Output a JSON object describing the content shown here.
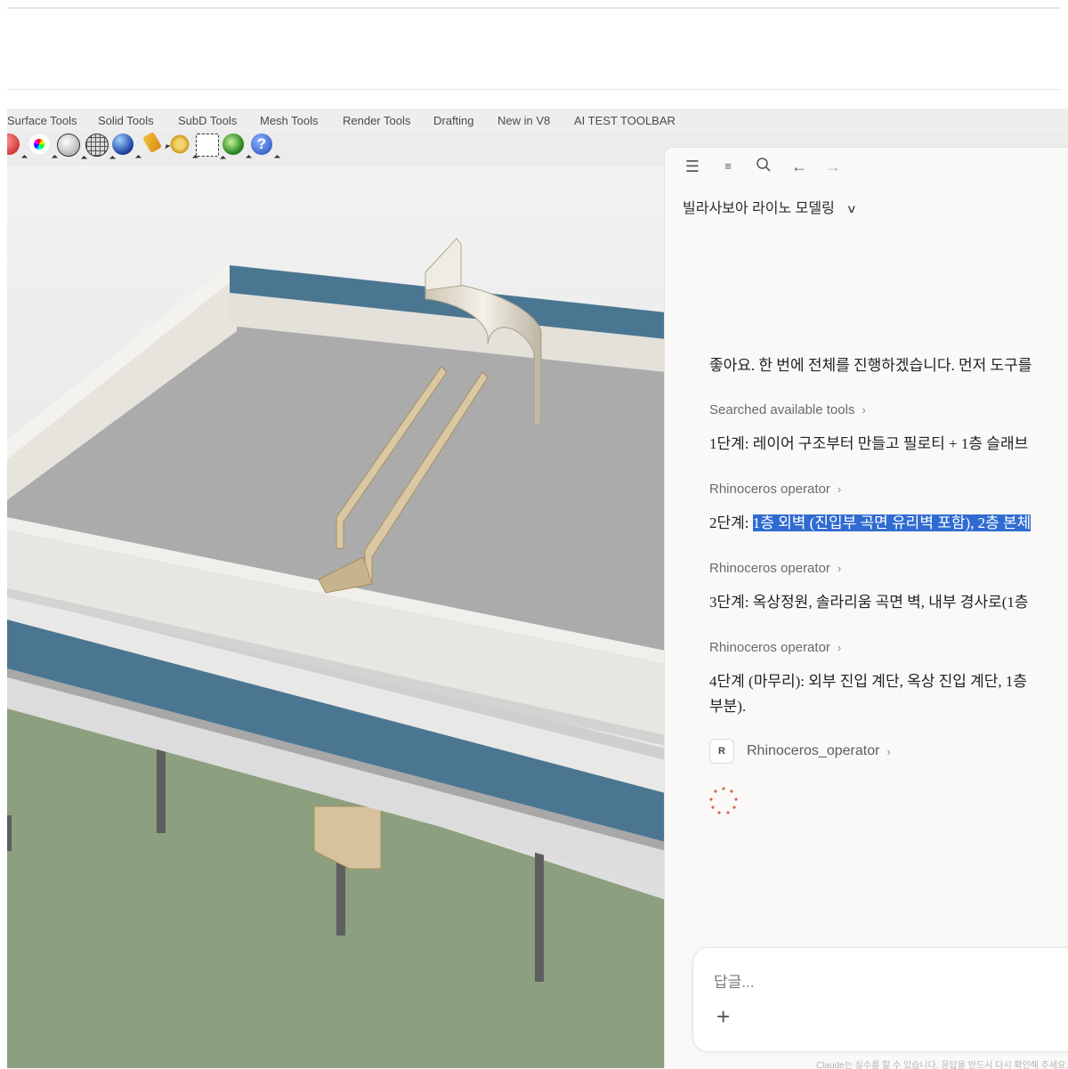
{
  "rhino": {
    "tabs": [
      "Surface Tools",
      "Solid Tools",
      "SubD Tools",
      "Mesh Tools",
      "Render Tools",
      "Drafting",
      "New in V8",
      "AI TEST TOOLBAR"
    ],
    "toolbar_icons": [
      "color-wheel-icon",
      "sphere-outline-icon",
      "grid-sphere-icon",
      "shaded-sphere-icon",
      "blue-sphere-icon",
      "light-icon",
      "gear-icon",
      "layout-icon",
      "globe-icon",
      "help-icon"
    ]
  },
  "chat": {
    "title": "빌라사보아 라이노 모델링",
    "intro": "좋아요. 한 번에 전체를 진행하겠습니다. 먼저 도구를",
    "searched_tools": "Searched available tools",
    "step1": "1단계: 레이어 구조부터 만들고 필로티 + 1층 슬래브",
    "tool_label": "Rhinoceros operator",
    "step2_prefix": "2단계: ",
    "step2_highlight": "1층 외벽 (진입부 곡면 유리벽 포함), 2층 본체",
    "step3": "3단계: 옥상정원, 솔라리움 곡면 벽, 내부 경사로(1층",
    "step4_line1": "4단계 (마무리): 외부 진입 계단, 옥상 진입 계단, 1층",
    "step4_line2": "부분).",
    "running_tool_badge": "R",
    "running_tool": "Rhinoceros_operator",
    "input_placeholder": "답글...",
    "footer": "Claude는 실수를 할 수 있습니다. 응답을 반드시 다시 확인해 주세요."
  },
  "colors": {
    "accent_highlight": "#2f6bd0",
    "ground_green": "#8c9f7e",
    "slab_blue": "#4b7692",
    "spinner": "#d6694b"
  }
}
